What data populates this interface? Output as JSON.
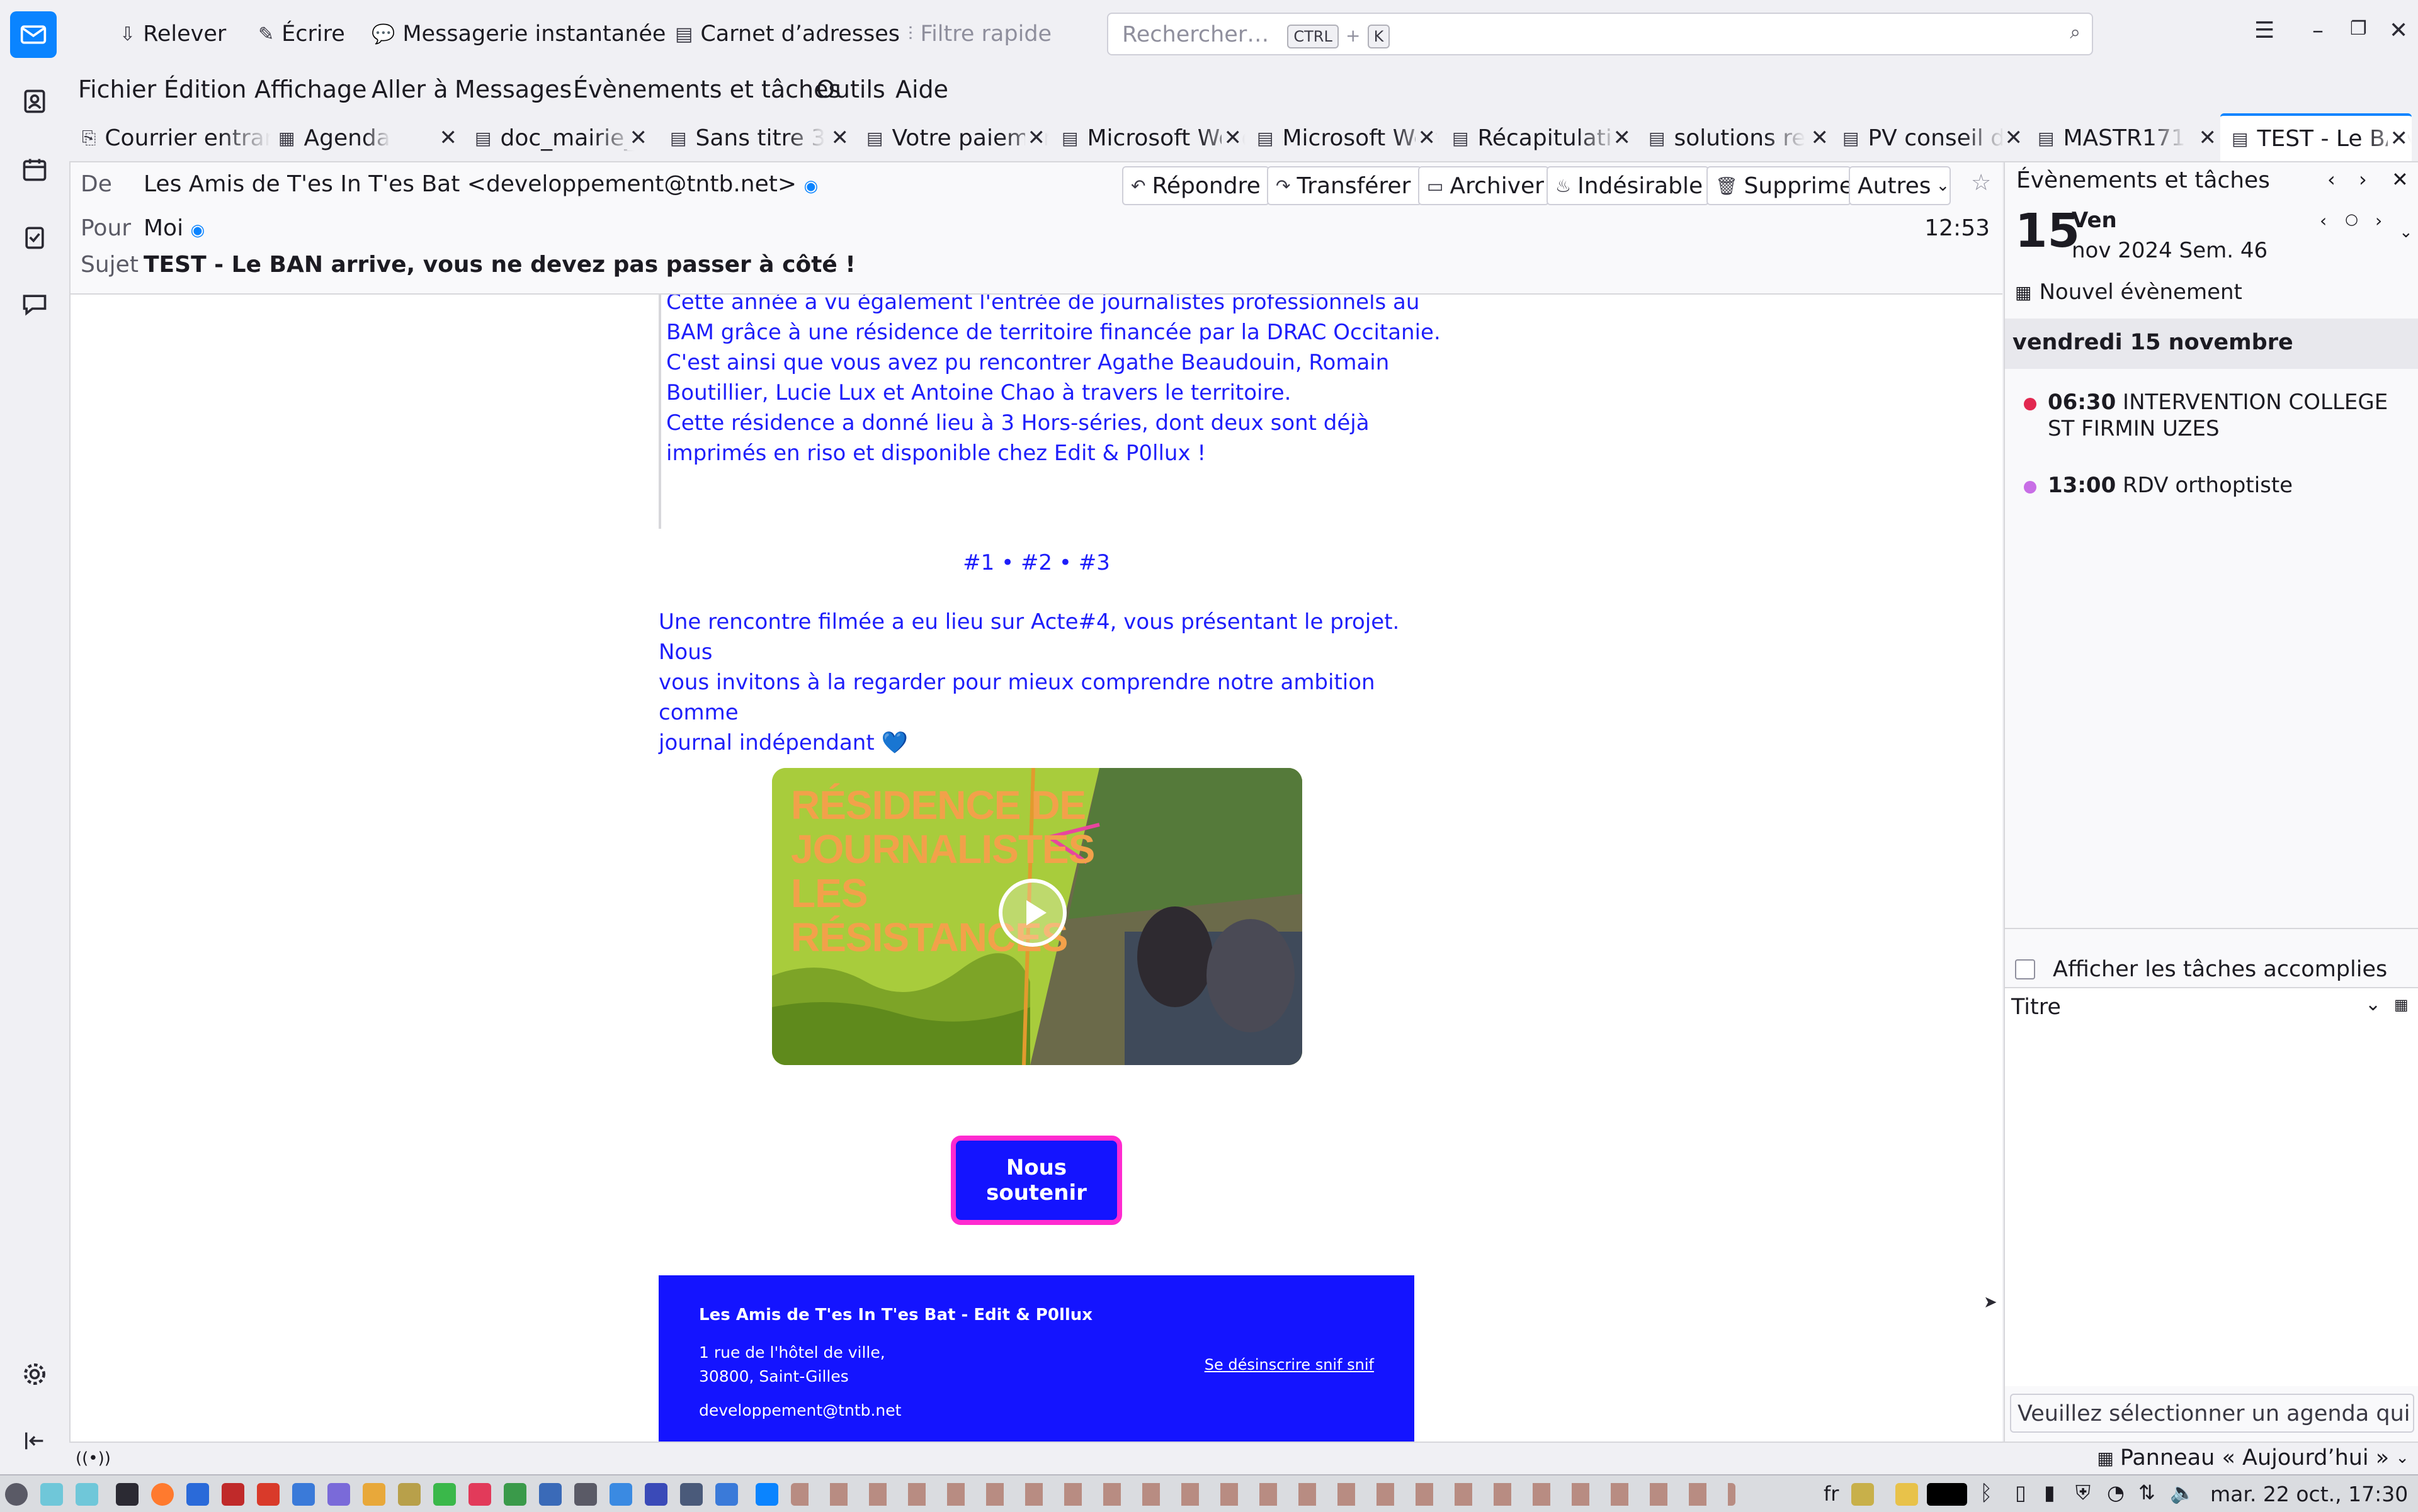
{
  "toolbar": {
    "get_messages": "Relever",
    "write": "Écrire",
    "chat": "Messagerie instantanée",
    "address_book": "Carnet d’adresses",
    "quick_filter": "Filtre rapide",
    "search_placeholder": "Rechercher…",
    "search_shortcut_mod": "CTRL",
    "search_shortcut_plus": "+",
    "search_shortcut_key": "K"
  },
  "menubar": [
    "Fichier",
    "Édition",
    "Affichage",
    "Aller à",
    "Messages",
    "Évènements et tâches",
    "Outils",
    "Aide"
  ],
  "tabs": [
    {
      "label": "Courrier entrant",
      "icon": "inbox-icon"
    },
    {
      "label": "Agenda",
      "icon": "calendar-icon"
    },
    {
      "label": "doc_mairie_",
      "icon": "message-icon"
    },
    {
      "label": "Sans titre 3",
      "icon": "message-icon"
    },
    {
      "label": "Votre paiement",
      "icon": "message-icon"
    },
    {
      "label": "Microsoft Word",
      "icon": "message-icon"
    },
    {
      "label": "Microsoft Word",
      "icon": "message-icon"
    },
    {
      "label": "Récapitulatif",
      "icon": "message-icon"
    },
    {
      "label": "solutions re",
      "icon": "message-icon"
    },
    {
      "label": "PV conseil d",
      "icon": "message-icon"
    },
    {
      "label": "MASTR171",
      "icon": "message-icon"
    },
    {
      "label": "TEST - Le BAN",
      "icon": "message-icon"
    }
  ],
  "message": {
    "from_label": "De",
    "from_value": "Les Amis de T'es In T'es Bat <developpement@tntb.net>",
    "to_label": "Pour",
    "to_value": "Moi",
    "subject_label": "Sujet",
    "subject_value": "TEST - Le BAN arrive, vous ne devez pas passer à côté !",
    "time": "12:53",
    "actions": {
      "reply": "Répondre",
      "forward": "Transférer",
      "archive": "Archiver",
      "junk": "Indésirable",
      "delete": "Supprimer",
      "more": "Autres"
    }
  },
  "body": {
    "para1_lines": [
      "Cette année a vu également l'entrée de journalistes professionnels au",
      "BAM grâce à une résidence de territoire financée par la DRAC Occitanie.",
      "C'est ainsi que vous avez pu rencontrer Agathe Beaudouin, Romain",
      "Boutillier, Lucie Lux et Antoine Chao à travers le territoire.",
      "Cette résidence a donné lieu à 3 Hors-séries, dont deux sont déjà",
      "imprimés en riso et disponible chez Edit & P0llux !"
    ],
    "hors_series": [
      "#1",
      "•",
      "#2",
      "•",
      "#3"
    ],
    "para2_lines": [
      "Une rencontre filmée a eu lieu sur Acte#4, vous présentant le projet. Nous",
      "vous invitons à la regarder pour mieux comprendre notre ambition comme",
      "journal indépendant 💙"
    ],
    "video_title_lines": [
      "RÉSIDENCE DE",
      "JOURNALISTES",
      "LES",
      "RÉSISTANCES"
    ],
    "support_button_lines": [
      "Nous",
      "soutenir"
    ],
    "footer": {
      "org": "Les Amis de T'es In T'es Bat - Edit & P0llux",
      "address_line1": "1 rue de l'hôtel de ville,",
      "address_line2": "30800, Saint-Gilles",
      "email": "developpement@tntb.net",
      "unsubscribe": "Se désinscrire snif snif"
    }
  },
  "today_pane": {
    "title": "Évènements et tâches",
    "day_number": "15",
    "weekday": "Ven",
    "month_week": "nov 2024 Sem. 46",
    "new_event": "Nouvel évènement",
    "date_heading": "vendredi 15 novembre",
    "events": [
      {
        "time": "06:30",
        "title_lines": [
          "INTERVENTION COLLEGE",
          "ST FIRMIN UZES"
        ],
        "color": "#e22850"
      },
      {
        "time": "13:00",
        "title_lines": [
          "RDV orthoptiste"
        ],
        "color": "#c86ee6"
      }
    ],
    "show_completed": "Afficher les tâches accomplies",
    "column_title": "Titre",
    "select_calendar_msg": "Veuillez sélectionner un agenda qui ne"
  },
  "statusbar": {
    "today_pane_toggle": "Panneau « Aujourd’hui »"
  },
  "taskbar": {
    "lang": "fr",
    "clock": "mar. 22 oct., 17:30"
  },
  "colors": {
    "accent": "#0a84ff",
    "newsletter_blue": "#1e1efa",
    "support_border": "#ff2ad0",
    "footer_bg": "#1414ff"
  }
}
